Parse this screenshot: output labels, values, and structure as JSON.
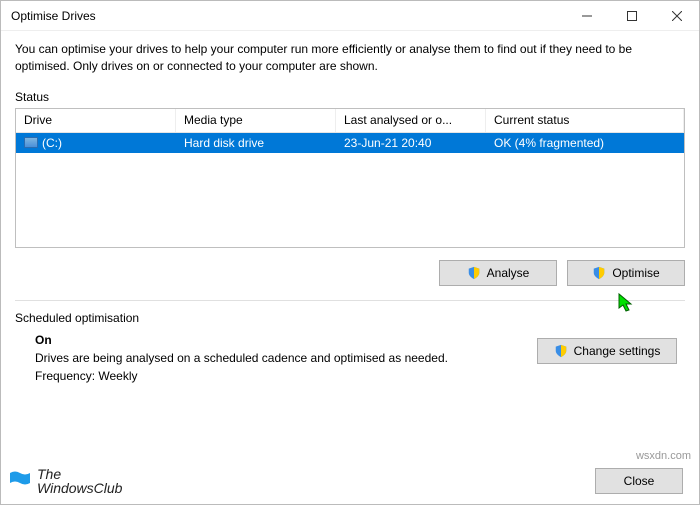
{
  "window": {
    "title": "Optimise Drives"
  },
  "description": "You can optimise your drives to help your computer run more efficiently or analyse them to find out if they need to be optimised. Only drives on or connected to your computer are shown.",
  "status": {
    "label": "Status",
    "columns": {
      "drive": "Drive",
      "media": "Media type",
      "last": "Last analysed or o...",
      "current": "Current status"
    },
    "rows": [
      {
        "drive": "(C:)",
        "media": "Hard disk drive",
        "last": "23-Jun-21 20:40",
        "current": "OK (4% fragmented)"
      }
    ]
  },
  "buttons": {
    "analyse": "Analyse",
    "optimise": "Optimise",
    "change": "Change settings",
    "close": "Close"
  },
  "schedule": {
    "label": "Scheduled optimisation",
    "state": "On",
    "desc": "Drives are being analysed on a scheduled cadence and optimised as needed.",
    "freq": "Frequency: Weekly"
  },
  "logo": {
    "line1": "The",
    "line2": "WindowsClub"
  },
  "watermark": "wsxdn.com"
}
